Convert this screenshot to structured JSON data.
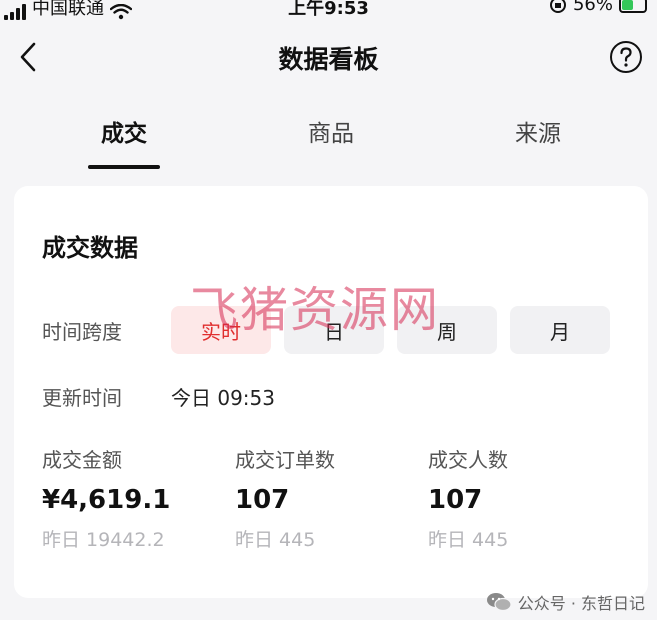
{
  "status_bar": {
    "carrier": "中国联通",
    "time": "上午9:53",
    "battery_percent": "56%",
    "battery_level": 0.56,
    "battery_color": "#34c759"
  },
  "header": {
    "title": "数据看板",
    "back_icon": "chevron-left-icon",
    "help_icon": "question-circle-icon"
  },
  "tabs": [
    {
      "label": "成交",
      "active": true
    },
    {
      "label": "商品",
      "active": false
    },
    {
      "label": "来源",
      "active": false
    }
  ],
  "card": {
    "title": "成交数据",
    "time_span": {
      "label": "时间跨度",
      "options": [
        "实时",
        "日",
        "周",
        "月"
      ],
      "selected": "实时"
    },
    "update_time": {
      "label": "更新时间",
      "value": "今日 09:53"
    },
    "metrics": [
      {
        "label": "成交金额",
        "value": "¥4,619.1",
        "yesterday": "昨日 19442.2"
      },
      {
        "label": "成交订单数",
        "value": "107",
        "yesterday": "昨日 445"
      },
      {
        "label": "成交人数",
        "value": "107",
        "yesterday": "昨日 445"
      }
    ]
  },
  "watermark": {
    "text": "飞猪资源网",
    "color": "#d62850"
  },
  "credit": {
    "text": "公众号 · 东哲日记",
    "icon": "wechat-icon"
  },
  "colors": {
    "accent": "#e02e2e",
    "active_bg": "#fde8e8",
    "page_bg": "#f5f5f7"
  }
}
